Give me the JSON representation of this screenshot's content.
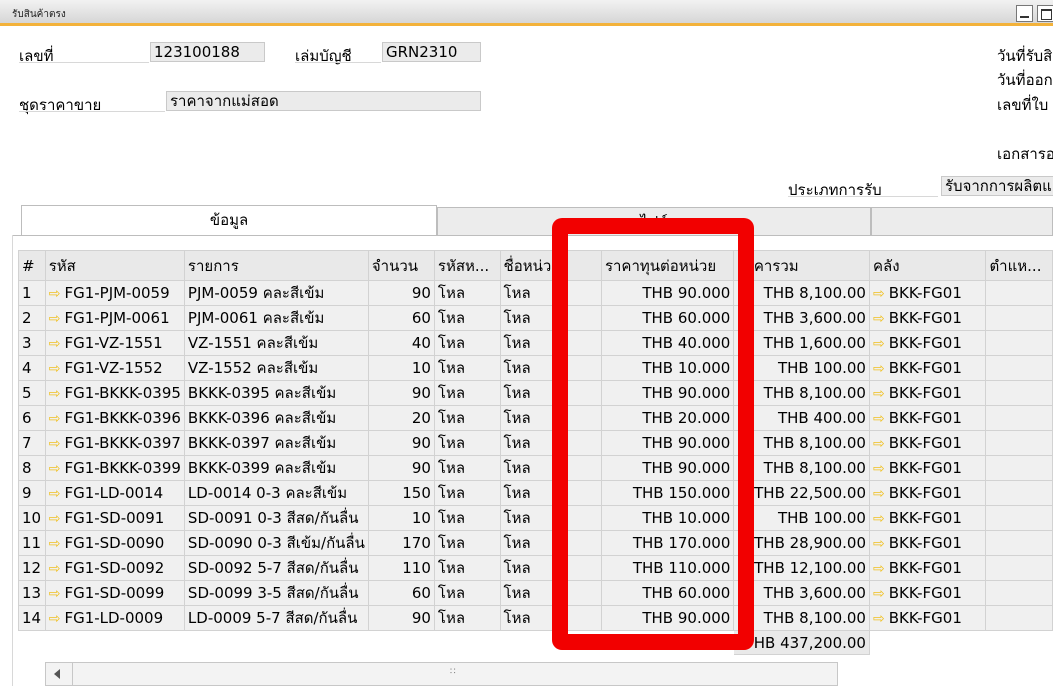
{
  "window": {
    "title": "รับสินค้าตรง"
  },
  "header": {
    "doc_no_label": "เลขที่",
    "doc_no_value": "123100188",
    "book_label": "เล่มบัญชี",
    "book_value": "GRN2310",
    "price_list_label": "ชุดราคาขาย",
    "price_list_value": "ราคาจากแม่สอด",
    "right_labels": [
      "วันที่รับสิ",
      "วันที่ออก",
      "เลขที่ใบ",
      "เอกสารอ"
    ],
    "receipt_type_label": "ประเภทการรับ",
    "receipt_type_value": "รับจากการผลิตแ"
  },
  "tabs": [
    {
      "label": "ข้อมูล"
    },
    {
      "label": "ไฟล์"
    },
    {
      "label": ""
    }
  ],
  "grid": {
    "columns": [
      "#",
      "รหัส",
      "รายการ",
      "จำนวน",
      "รหัสห...",
      "ชื่อหน่วย",
      "ราคาทุนต่อหน่วย",
      "ราคารวม",
      "คลัง",
      "ตำแห..."
    ],
    "rows": [
      {
        "no": "1",
        "code": "FG1-PJM-0059",
        "desc": "PJM-0059  คละสีเข้ม",
        "qty": "90",
        "unit_code": "โหล",
        "unit_name": "โหล",
        "unit_cost": "THB 90.000",
        "total": "THB 8,100.00",
        "warehouse": "BKK-FG01"
      },
      {
        "no": "2",
        "code": "FG1-PJM-0061",
        "desc": "PJM-0061  คละสีเข้ม",
        "qty": "60",
        "unit_code": "โหล",
        "unit_name": "โหล",
        "unit_cost": "THB 60.000",
        "total": "THB 3,600.00",
        "warehouse": "BKK-FG01"
      },
      {
        "no": "3",
        "code": "FG1-VZ-1551",
        "desc": "VZ-1551 คละสีเข้ม",
        "qty": "40",
        "unit_code": "โหล",
        "unit_name": "โหล",
        "unit_cost": "THB 40.000",
        "total": "THB 1,600.00",
        "warehouse": "BKK-FG01"
      },
      {
        "no": "4",
        "code": "FG1-VZ-1552",
        "desc": "VZ-1552 คละสีเข้ม",
        "qty": "10",
        "unit_code": "โหล",
        "unit_name": "โหล",
        "unit_cost": "THB 10.000",
        "total": "THB 100.00",
        "warehouse": "BKK-FG01"
      },
      {
        "no": "5",
        "code": "FG1-BKKK-0395",
        "desc": "BKKK-0395  คละสีเข้ม",
        "qty": "90",
        "unit_code": "โหล",
        "unit_name": "โหล",
        "unit_cost": "THB 90.000",
        "total": "THB 8,100.00",
        "warehouse": "BKK-FG01"
      },
      {
        "no": "6",
        "code": "FG1-BKKK-0396",
        "desc": "BKKK-0396  คละสีเข้ม",
        "qty": "20",
        "unit_code": "โหล",
        "unit_name": "โหล",
        "unit_cost": "THB 20.000",
        "total": "THB 400.00",
        "warehouse": "BKK-FG01"
      },
      {
        "no": "7",
        "code": "FG1-BKKK-0397",
        "desc": "BKKK-0397  คละสีเข้ม",
        "qty": "90",
        "unit_code": "โหล",
        "unit_name": "โหล",
        "unit_cost": "THB 90.000",
        "total": "THB 8,100.00",
        "warehouse": "BKK-FG01"
      },
      {
        "no": "8",
        "code": "FG1-BKKK-0399",
        "desc": "BKKK-0399  คละสีเข้ม",
        "qty": "90",
        "unit_code": "โหล",
        "unit_name": "โหล",
        "unit_cost": "THB 90.000",
        "total": "THB 8,100.00",
        "warehouse": "BKK-FG01"
      },
      {
        "no": "9",
        "code": "FG1-LD-0014",
        "desc": "LD-0014 0-3 คละสีเข้ม",
        "qty": "150",
        "unit_code": "โหล",
        "unit_name": "โหล",
        "unit_cost": "THB 150.000",
        "total": "THB 22,500.00",
        "warehouse": "BKK-FG01"
      },
      {
        "no": "10",
        "code": "FG1-SD-0091",
        "desc": "SD-0091 0-3 สีสด/กันลื่น",
        "qty": "10",
        "unit_code": "โหล",
        "unit_name": "โหล",
        "unit_cost": "THB 10.000",
        "total": "THB 100.00",
        "warehouse": "BKK-FG01"
      },
      {
        "no": "11",
        "code": "FG1-SD-0090",
        "desc": "SD-0090  0-3  สีเข้ม/กันลื่น",
        "qty": "170",
        "unit_code": "โหล",
        "unit_name": "โหล",
        "unit_cost": "THB 170.000",
        "total": "THB 28,900.00",
        "warehouse": "BKK-FG01"
      },
      {
        "no": "12",
        "code": "FG1-SD-0092",
        "desc": "SD-0092 5-7 สีสด/กันลื่น",
        "qty": "110",
        "unit_code": "โหล",
        "unit_name": "โหล",
        "unit_cost": "THB 110.000",
        "total": "THB 12,100.00",
        "warehouse": "BKK-FG01"
      },
      {
        "no": "13",
        "code": "FG1-SD-0099",
        "desc": "SD-0099 3-5 สีสด/กันลื่น",
        "qty": "60",
        "unit_code": "โหล",
        "unit_name": "โหล",
        "unit_cost": "THB 60.000",
        "total": "THB 3,600.00",
        "warehouse": "BKK-FG01"
      },
      {
        "no": "14",
        "code": "FG1-LD-0009",
        "desc": "LD-0009 5-7 สีสด/กันลื่น",
        "qty": "90",
        "unit_code": "โหล",
        "unit_name": "โหล",
        "unit_cost": "THB 90.000",
        "total": "THB 8,100.00",
        "warehouse": "BKK-FG01"
      }
    ],
    "grand_total": "THB 437,200.00"
  },
  "highlight": {
    "color": "#f20000",
    "target_column": "ราคาทุนต่อหน่วย"
  },
  "icons": {
    "row_link": "yellow-right-arrow-icon"
  },
  "colors": {
    "accent_line": "#f3b23a",
    "field_bg": "#ebebeb",
    "grid_bg": "#f0f0f0"
  }
}
